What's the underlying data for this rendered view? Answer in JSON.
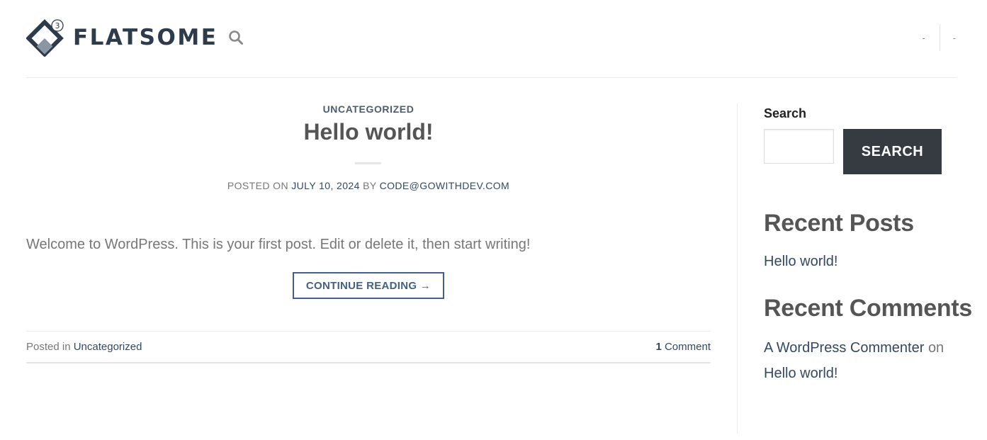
{
  "header": {
    "logo_text": "FLATSOME",
    "logo_badge": "3",
    "search_icon": "search-icon",
    "nav_links": [
      "-",
      "-"
    ]
  },
  "post": {
    "category": "UNCATEGORIZED",
    "title": "Hello world!",
    "meta": {
      "posted_on_label": "POSTED ON",
      "date": "JULY 10, 2024",
      "by_label": "BY",
      "author": "CODE@GOWITHDEV.COM"
    },
    "excerpt": "Welcome to WordPress. This is your first post. Edit or delete it, then start writing!",
    "continue_label": "CONTINUE READING →",
    "footer": {
      "posted_in_label": "Posted in",
      "category_link": "Uncategorized",
      "comment_count": "1",
      "comment_label": "Comment"
    }
  },
  "sidebar": {
    "search_label": "Search",
    "search_input_value": "",
    "search_button_label": "SEARCH",
    "recent_posts_title": "Recent Posts",
    "recent_posts": [
      "Hello world!"
    ],
    "recent_comments_title": "Recent Comments",
    "recent_comments": [
      {
        "author": "A WordPress Commenter",
        "on_label": "on",
        "post": "Hello world!"
      }
    ]
  },
  "colors": {
    "link": "#334862",
    "primary": "#446084",
    "button_dark": "#353b40",
    "heading": "#555555",
    "body_text": "#777777"
  }
}
